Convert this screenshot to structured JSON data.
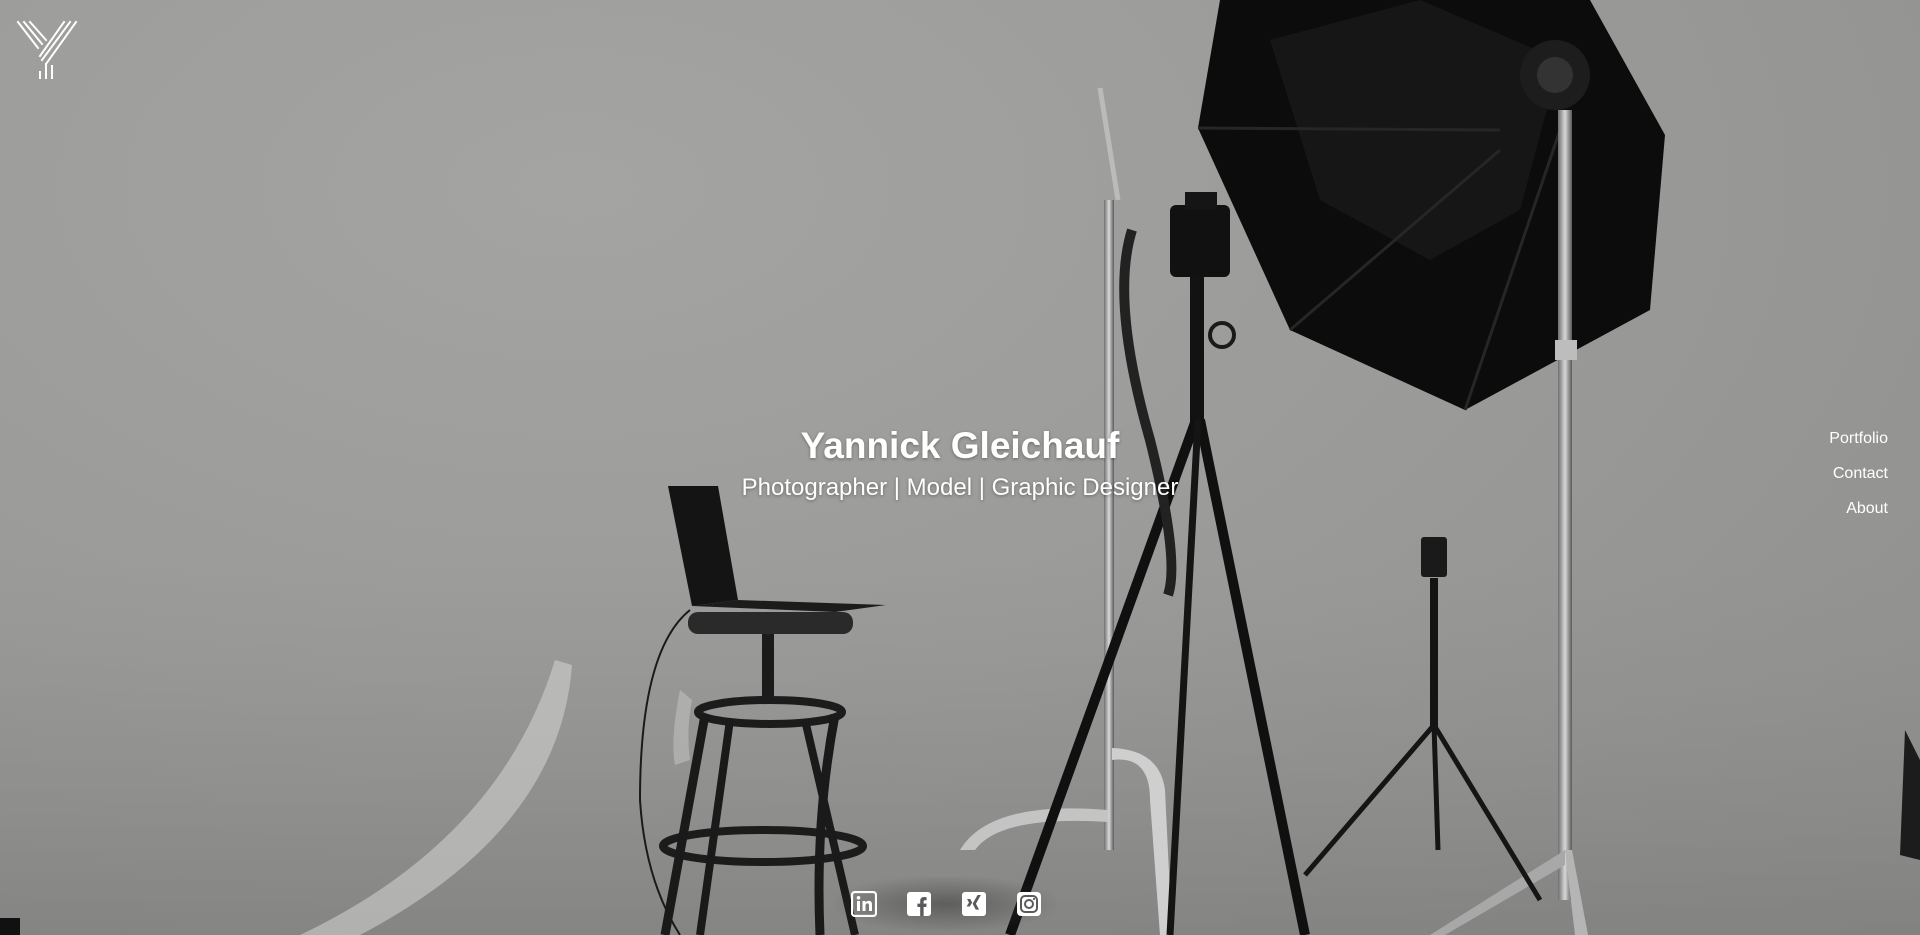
{
  "site": {
    "name": "Yannick Gleichauf",
    "tagline": "Photographer | Model | Graphic Designer"
  },
  "logo": {
    "icon": "y-monogram-logo-icon"
  },
  "nav": {
    "items": [
      {
        "label": "Portfolio"
      },
      {
        "label": "Contact"
      },
      {
        "label": "About"
      }
    ]
  },
  "social": {
    "items": [
      {
        "icon": "linkedin-icon"
      },
      {
        "icon": "facebook-icon"
      },
      {
        "icon": "xing-icon"
      },
      {
        "icon": "instagram-icon"
      }
    ]
  },
  "colors": {
    "text": "#ffffff",
    "backdrop": "#9b9b99",
    "equipment": "#111111"
  }
}
